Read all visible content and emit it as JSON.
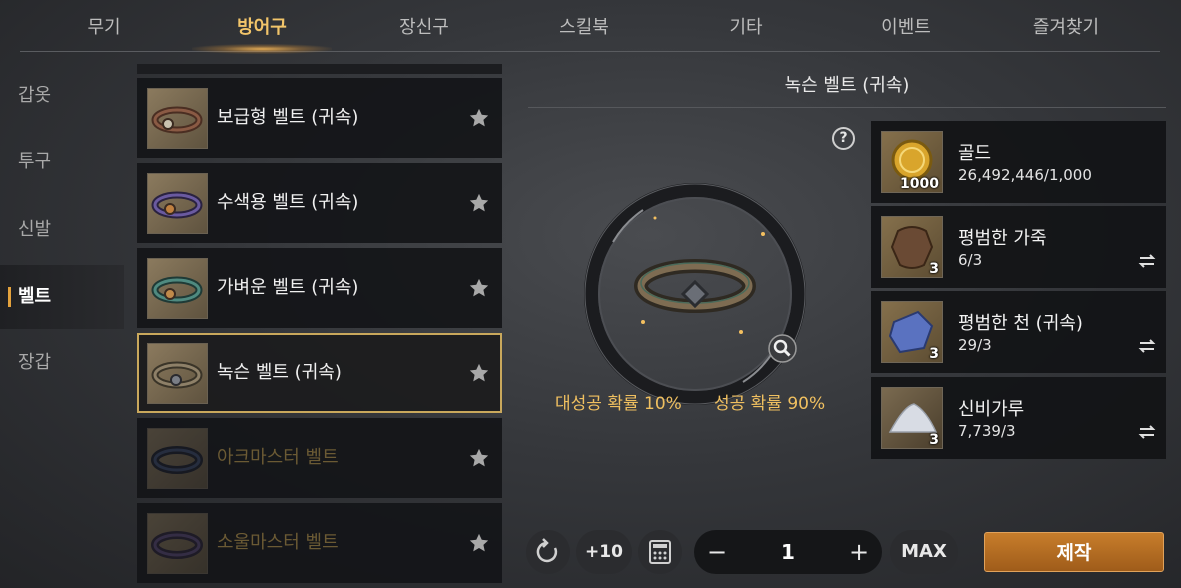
{
  "tabs": [
    {
      "label": "무기"
    },
    {
      "label": "방어구"
    },
    {
      "label": "장신구"
    },
    {
      "label": "스킬북"
    },
    {
      "label": "기타"
    },
    {
      "label": "이벤트"
    },
    {
      "label": "즐겨찾기"
    }
  ],
  "active_tab": "방어구",
  "categories": [
    {
      "label": "갑옷"
    },
    {
      "label": "투구"
    },
    {
      "label": "신발"
    },
    {
      "label": "벨트"
    },
    {
      "label": "장갑"
    }
  ],
  "active_category": "벨트",
  "items": [
    {
      "name": "보급형 벨트 (귀속)",
      "state": "normal"
    },
    {
      "name": "수색용 벨트 (귀속)",
      "state": "normal"
    },
    {
      "name": "가벼운 벨트 (귀속)",
      "state": "normal"
    },
    {
      "name": "녹슨 벨트 (귀속)",
      "state": "selected"
    },
    {
      "name": "아크마스터 벨트",
      "state": "locked"
    },
    {
      "name": "소울마스터 벨트",
      "state": "locked"
    }
  ],
  "detail": {
    "title": "녹슨 벨트 (귀속)",
    "help_label": "?",
    "great_success": "대성공 확률 10%",
    "success": "성공 확률 90%"
  },
  "materials": [
    {
      "name": "골드",
      "count": "26,492,446/1,000",
      "badge": "1000",
      "icon": "gold-coin-icon"
    },
    {
      "name": "평범한 가죽",
      "count": "6/3",
      "badge": "3",
      "icon": "leather-icon"
    },
    {
      "name": "평범한 천 (귀속)",
      "count": "29/3",
      "badge": "3",
      "icon": "cloth-icon"
    },
    {
      "name": "신비가루",
      "count": "7,739/3",
      "badge": "3",
      "icon": "powder-icon"
    }
  ],
  "controls": {
    "plus10": "+10",
    "minus": "−",
    "quantity": "1",
    "plus": "+",
    "max": "MAX",
    "craft": "제작"
  },
  "colors": {
    "accent": "#f2c56a",
    "rate": "#f0c060",
    "craft_button": "#c77d2b",
    "selected_border": "#c9a85c"
  }
}
